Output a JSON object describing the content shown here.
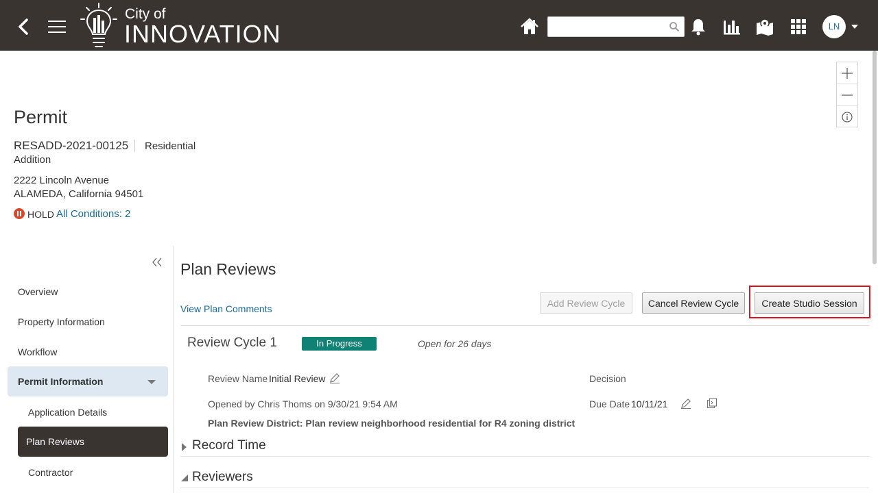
{
  "header": {
    "logo_city": "City of",
    "logo_name": "INNOVATION",
    "search": {
      "value": "",
      "placeholder": ""
    },
    "avatar_initials": "LN",
    "icons": [
      "back-icon",
      "hamburger-menu-icon",
      "lightbulb-logo-icon",
      "home-icon",
      "search-icon",
      "bell-icon",
      "bar-chart-icon",
      "map-icon",
      "apps-grid-icon",
      "chevron-down-icon"
    ],
    "bg_color": "#3a3431"
  },
  "permit": {
    "title": "Permit",
    "id": "RESADD-2021-00125",
    "type_line1": "Residential",
    "type_line2": "Addition",
    "address_line1": "2222 Lincoln Avenue",
    "address_line2": "ALAMEDA, California 94501",
    "hold_label": "HOLD",
    "conditions_link": "All Conditions: 2"
  },
  "sidebar": {
    "items": [
      {
        "label": "Overview"
      },
      {
        "label": "Property Information"
      },
      {
        "label": "Workflow"
      }
    ],
    "active_group": "Permit Information",
    "sub_items": [
      {
        "label": "Application Details"
      },
      {
        "label": "Plan Reviews"
      },
      {
        "label": "Contractor"
      }
    ]
  },
  "main": {
    "section_title": "Plan Reviews",
    "view_comments_link": "View Plan Comments",
    "buttons": {
      "add_review_cycle": "Add Review Cycle",
      "cancel_review_cycle": "Cancel Review Cycle",
      "create_studio_session": "Create Studio Session"
    },
    "cycle": {
      "title": "Review Cycle 1",
      "status": "In Progress",
      "status_color": "#108275",
      "open_for": "Open for 26 days",
      "review_name_label": "Review Name",
      "review_name_value": "Initial Review",
      "decision_label": "Decision",
      "opened_by": "Opened by Chris Thoms on 9/30/21 9:54 AM",
      "due_date_label": "Due Date",
      "due_date_value": "10/11/21",
      "district": "Plan Review District: Plan review neighborhood residential for R4 zoning district"
    },
    "sections": {
      "record_time": "Record Time",
      "reviewers": "Reviewers"
    }
  },
  "colors": {
    "link": "#1a6a9a",
    "highlight_border": "#e0141e",
    "nav_active_bg": "#dde8f3",
    "nav_selected_bg": "#3a3431"
  }
}
